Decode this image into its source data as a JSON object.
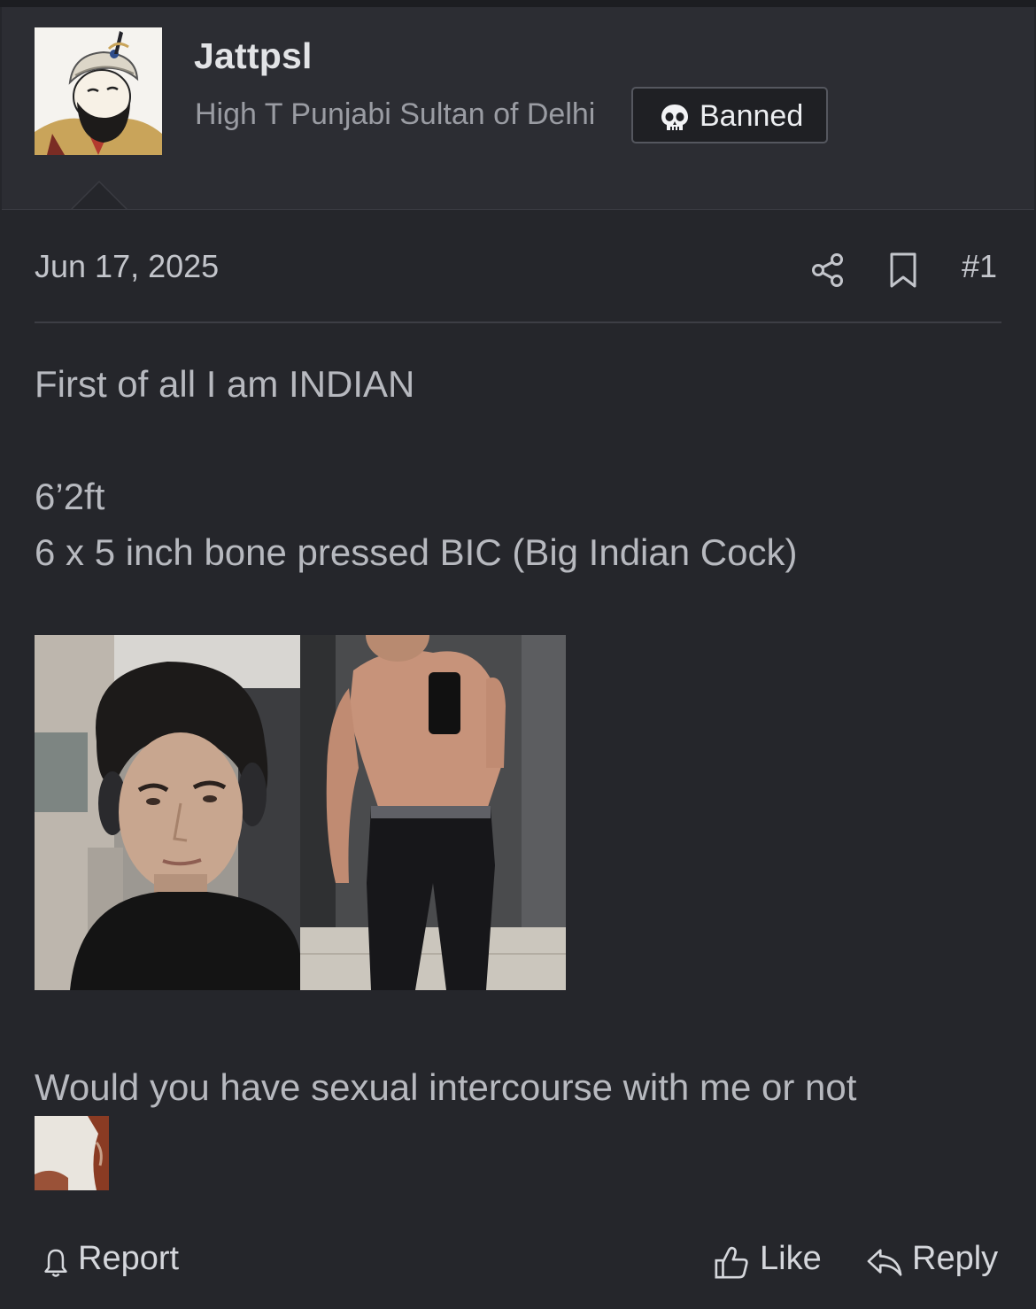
{
  "post": {
    "author": {
      "username": "Jattpsl",
      "title": "High T Punjabi Sultan of Delhi",
      "badge": {
        "icon": "skull-icon",
        "label": "Banned"
      }
    },
    "date": "Jun 17, 2025",
    "post_number": "#1",
    "header_icons": [
      "share-icon",
      "bookmark-icon"
    ],
    "body_lines": [
      "First of all I am INDIAN",
      "6’2ft",
      "6 x 5 inch bone pressed BIC (Big Indian Cock)",
      "Would you have sexual intercourse with me or not"
    ],
    "images": [
      "selfie-face-photo",
      "gym-mirror-selfie-photo",
      "small-thumbnail-image"
    ]
  },
  "footer": {
    "report_label": "Report",
    "like_label": "Like",
    "reply_label": "Reply"
  },
  "colors": {
    "background": "#25262b",
    "user_block": "#2c2d33",
    "text": "#b7b9bf",
    "muted": "#9a9ca3"
  }
}
